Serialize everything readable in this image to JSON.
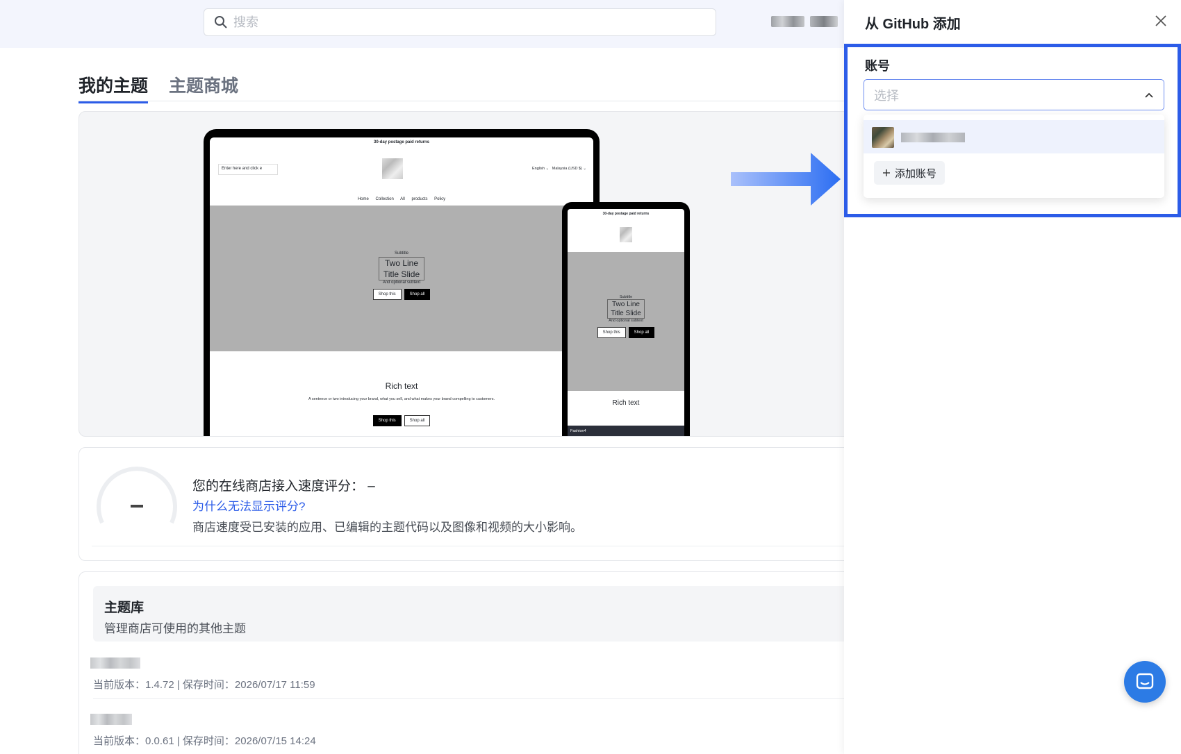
{
  "search": {
    "placeholder": "搜索"
  },
  "tabs": [
    {
      "label": "我的主题"
    },
    {
      "label": "主题商城"
    }
  ],
  "preview": {
    "announcement": "30-day postage paid returns",
    "search_placeholder": "Enter here and click e",
    "language": "English ⌄",
    "currency": "Malaysia (USD $) ⌄",
    "nav": "Home Collection All products Policy",
    "hero_subtitle": "Subtitle",
    "hero_title_1": "Two Line",
    "hero_title_2": "Title Slide",
    "hero_optional": "And optional subtext",
    "btn_shop_this": "Shop this",
    "btn_shop_all": "Shop all",
    "rich_text_title": "Rich text",
    "rich_text_body": "A sentence or two introducing your brand, what you sell, and what makes your brand compelling to customers.",
    "phone_bar": "Fashion4"
  },
  "speed": {
    "title": "您的在线商店接入速度评分： –",
    "link": "为什么无法显示评分?",
    "description": "商店速度受已安装的应用、已编辑的主题代码以及图像和视频的大小影响。"
  },
  "library": {
    "title": "主题库",
    "subtitle": "管理商店可使用的其他主题",
    "rows": [
      {
        "meta": "当前版本：1.4.72 | 保存时间：2026/07/17 11:59"
      },
      {
        "meta": "当前版本：0.0.61 | 保存时间：2026/07/15 14:24"
      }
    ]
  },
  "panel": {
    "title": "从 GitHub 添加",
    "account_label": "账号",
    "select_placeholder": "选择",
    "add_account": "添加账号"
  },
  "colors": {
    "accent": "#2c5ce8",
    "highlight": "#2c5ce8",
    "chat": "#2c7be5"
  },
  "icons": [
    "search-icon",
    "close-icon",
    "chevron-up-icon",
    "plus-icon",
    "chat-icon",
    "arrow-right-icon"
  ]
}
